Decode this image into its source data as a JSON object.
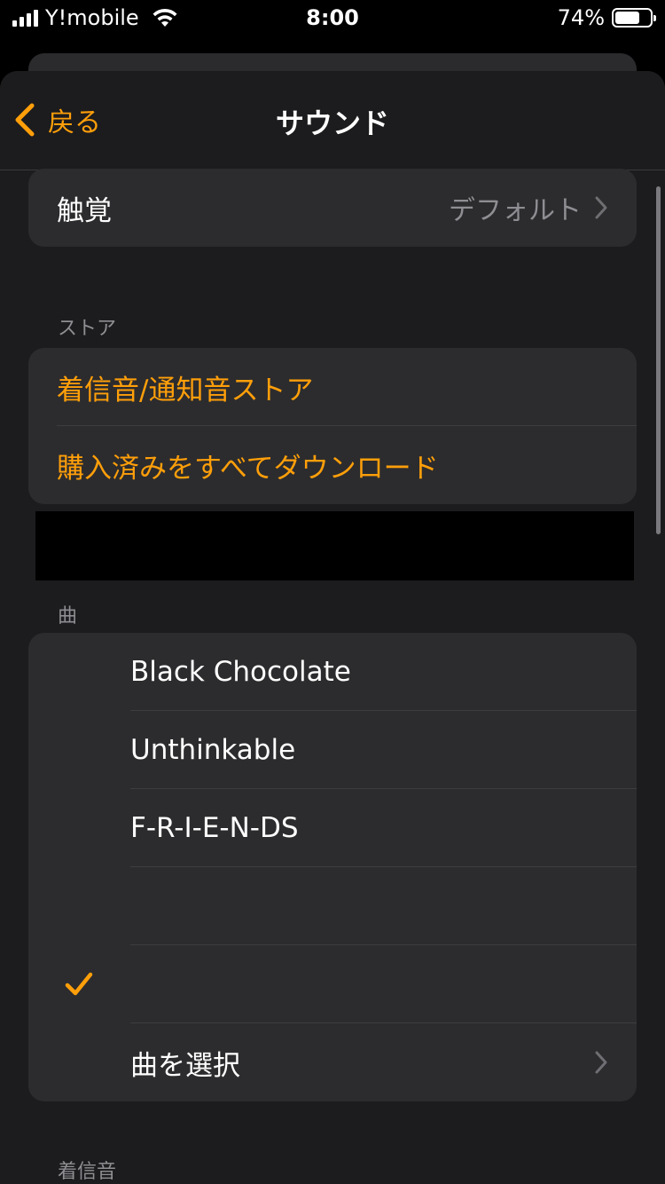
{
  "status_bar": {
    "carrier": "Y!mobile",
    "time": "8:00",
    "battery_percent": "74%",
    "battery_level": 0.74
  },
  "nav": {
    "back_label": "戻る",
    "title": "サウンド"
  },
  "haptics_row": {
    "label": "触覚",
    "value": "デフォルト"
  },
  "store_section": {
    "header": "ストア",
    "items": [
      {
        "label": "着信音/通知音ストア"
      },
      {
        "label": "購入済みをすべてダウンロード"
      }
    ]
  },
  "songs_section": {
    "header": "曲",
    "items": [
      {
        "label": "Black Chocolate",
        "checked": false
      },
      {
        "label": "Unthinkable",
        "checked": false
      },
      {
        "label": "F-R-I-E-N-DS",
        "checked": false
      },
      {
        "label": "",
        "checked": false
      },
      {
        "label": "",
        "checked": true
      },
      {
        "label": "曲を選択",
        "has_chevron": true
      }
    ]
  },
  "ringtones_section": {
    "header": "着信音"
  },
  "colors": {
    "accent": "#ff9f0a",
    "background": "#000000",
    "sheet": "#1c1c1e",
    "cell": "#2c2c2e",
    "secondary_text": "#8e8e93"
  },
  "icons": {
    "back": "chevron-left-icon",
    "disclosure": "chevron-right-icon",
    "selected": "checkmark-icon",
    "wifi": "wifi-icon",
    "signal": "cellular-signal-icon",
    "battery": "battery-icon"
  }
}
